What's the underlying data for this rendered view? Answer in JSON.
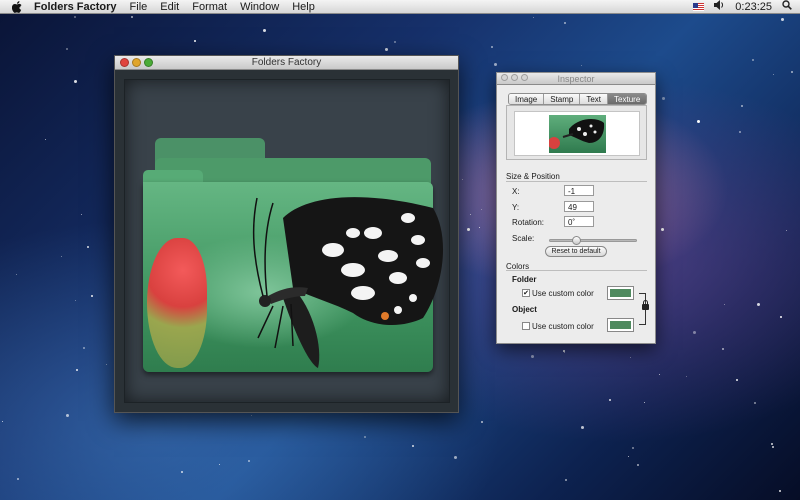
{
  "menubar": {
    "app": "Folders Factory",
    "items": [
      "File",
      "Edit",
      "Format",
      "Window",
      "Help"
    ],
    "clock": "0:23:25",
    "icons": [
      "apple-icon",
      "flag-icon",
      "volume-icon",
      "search-icon"
    ]
  },
  "main_window": {
    "title": "Folders Factory"
  },
  "inspector": {
    "title": "Inspector",
    "tabs": [
      "Image",
      "Stamp",
      "Text",
      "Texture"
    ],
    "selected_tab": "Texture",
    "size_position": {
      "heading": "Size & Position",
      "x_label": "X:",
      "x_value": "-1",
      "y_label": "Y:",
      "y_value": "49",
      "rotation_label": "Rotation:",
      "rotation_value": "0˚",
      "scale_label": "Scale:",
      "scale_value": 0.3,
      "reset": "Reset to default"
    },
    "colors": {
      "heading": "Colors",
      "folder_heading": "Folder",
      "folder_checkbox": "Use custom color",
      "folder_checked": true,
      "object_heading": "Object",
      "object_checkbox": "Use custom color",
      "object_checked": false,
      "folder_color": "#4f8a5f",
      "object_color": "#4f8a5f"
    }
  },
  "colors": {
    "folder_green": "#57ab76",
    "accent": "#6a6a6a"
  }
}
